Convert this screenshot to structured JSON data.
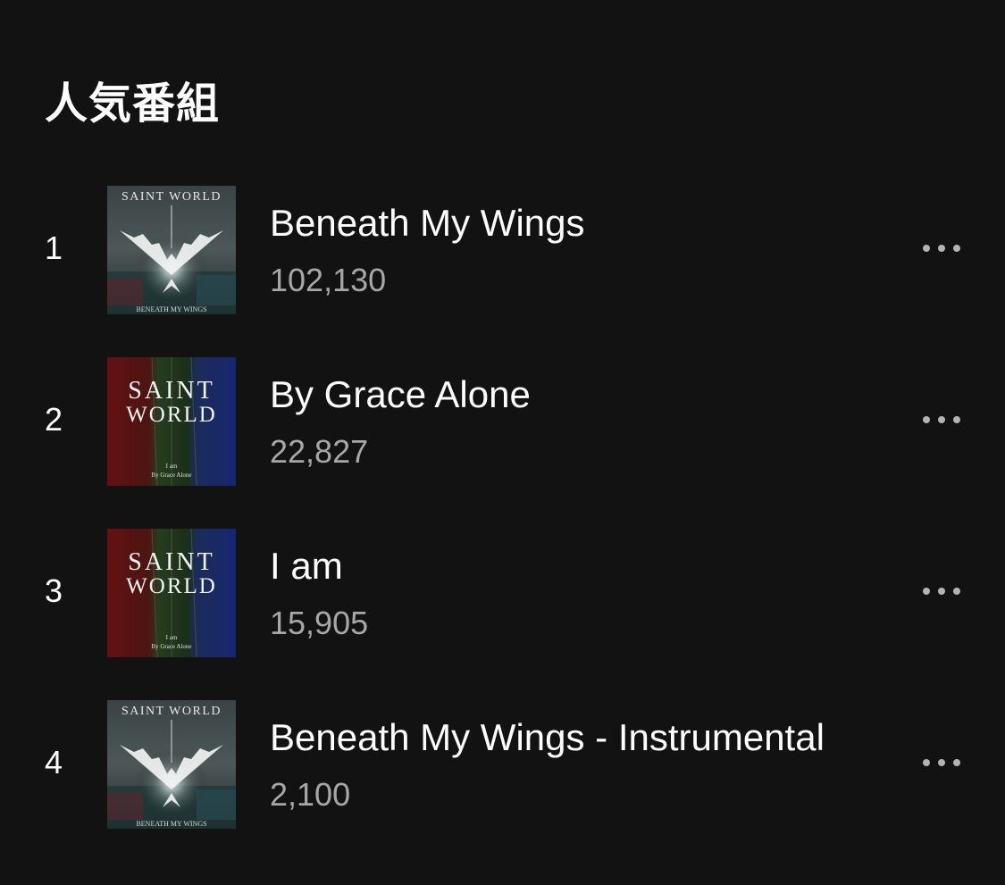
{
  "section": {
    "title": "人気番組"
  },
  "tracks": [
    {
      "rank": "1",
      "title": "Beneath My Wings",
      "plays": "102,130",
      "cover": {
        "style": "wings",
        "top_text": "SAINT WORLD",
        "bottom_text": "BENEATH MY WINGS"
      }
    },
    {
      "rank": "2",
      "title": "By Grace Alone",
      "plays": "22,827",
      "cover": {
        "style": "tricolor",
        "line1": "SAINT",
        "line2": "WORLD",
        "caption1": "I am",
        "caption2": "By Grace Alone"
      }
    },
    {
      "rank": "3",
      "title": "I am",
      "plays": "15,905",
      "cover": {
        "style": "tricolor",
        "line1": "SAINT",
        "line2": "WORLD",
        "caption1": "I am",
        "caption2": "By Grace Alone"
      }
    },
    {
      "rank": "4",
      "title": "Beneath My Wings - Instrumental",
      "plays": "2,100",
      "cover": {
        "style": "wings",
        "top_text": "SAINT WORLD",
        "bottom_text": "BENEATH MY WINGS"
      }
    }
  ],
  "icons": {
    "more": "more-horizontal-icon"
  },
  "colors": {
    "background": "#121212",
    "primary_text": "#ffffff",
    "secondary_text": "#a7a7a7",
    "icon": "#b3b3b3"
  }
}
